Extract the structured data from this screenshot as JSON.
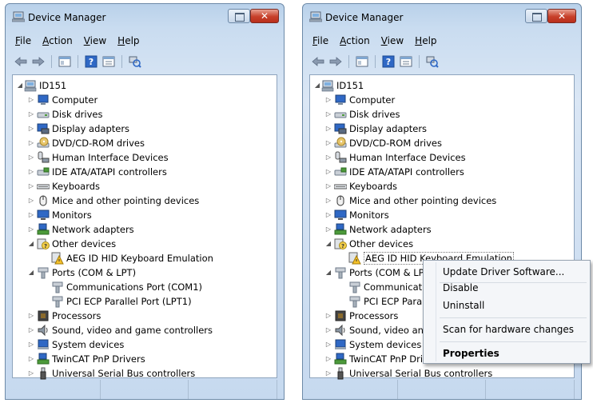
{
  "window": {
    "title": "Device Manager",
    "close_glyph": "✕"
  },
  "menu": [
    "File",
    "Action",
    "View",
    "Help"
  ],
  "toolbar": {
    "icons": [
      "back-arrow-icon",
      "forward-arrow-icon",
      "show-hide-console-tree-icon",
      "help-icon",
      "properties-icon",
      "scan-hardware-icon"
    ]
  },
  "tree": {
    "root": "ID151",
    "categories": [
      "Computer",
      "Disk drives",
      "Display adapters",
      "DVD/CD-ROM drives",
      "Human Interface Devices",
      "IDE ATA/ATAPI controllers",
      "Keyboards",
      "Mice and other pointing devices",
      "Monitors",
      "Network adapters",
      "Other devices",
      "AEG ID HID Keyboard Emulation",
      "Ports (COM & LPT)",
      "Communications Port (COM1)",
      "PCI ECP Parallel Port (LPT1)",
      "Processors",
      "Sound, video and game controllers",
      "System devices",
      "TwinCAT PnP Drivers",
      "Universal Serial Bus controllers"
    ]
  },
  "context_menu": {
    "items": [
      "Update Driver Software...",
      "Disable",
      "Uninstall",
      "Scan for hardware changes",
      "Properties"
    ]
  },
  "colors": {
    "frame": "#c6d9ef",
    "close_button": "#c7402a",
    "content_bg": "#ffffff"
  }
}
